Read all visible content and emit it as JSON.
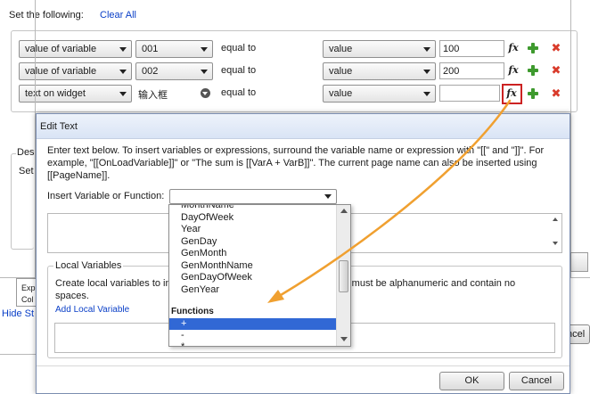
{
  "conditions": {
    "header": {
      "set_label": "Set the following:",
      "clear_all": "Clear All"
    },
    "rows": [
      {
        "target": "value of variable",
        "name": "001",
        "op": "equal to",
        "kind": "value",
        "input": "100"
      },
      {
        "target": "value of variable",
        "name": "002",
        "op": "equal to",
        "kind": "value",
        "input": "200"
      },
      {
        "target": "text on widget",
        "name": "输入框",
        "op": "equal to",
        "kind": "value",
        "input": ""
      }
    ],
    "fx_glyph": "fx",
    "delete_glyph": "✖",
    "partial_labels": {
      "desc": "Des",
      "set": "Set",
      "exp": "Exp",
      "col": "Col",
      "hide": "Hide St",
      "cancel_partial": "ncel"
    }
  },
  "dialog": {
    "title": "Edit Text",
    "instructions": "Enter text below. To insert variables or expressions, surround the variable name or expression with \"[[\" and \"]]\". For example, \"[[OnLoadVariable]]\" or \"The sum is [[VarA + VarB]]\". The current page name can also be inserted using [[PageName]].",
    "insert_label": "Insert Variable or Function:",
    "insert_value": "",
    "local_vars": {
      "title": "Local Variables",
      "desc_left": "Create local variables to in",
      "desc_right": "es must be alphanumeric and contain no",
      "desc_line2": "spaces.",
      "add_link": "Add Local Variable"
    },
    "ok_label": "OK",
    "cancel_label": "Cancel"
  },
  "dropdown": {
    "items": [
      "MonthName",
      "DayOfWeek",
      "Year",
      "GenDay",
      "GenMonth",
      "GenMonthName",
      "GenDayOfWeek",
      "GenYear"
    ],
    "section": "Functions",
    "functions": [
      "+",
      "-",
      "*"
    ]
  },
  "colors": {
    "accent_link": "#0a3fc7",
    "arrow": "#f0a030",
    "highlight": "#3168d5",
    "fx_box": "#cc2222"
  }
}
